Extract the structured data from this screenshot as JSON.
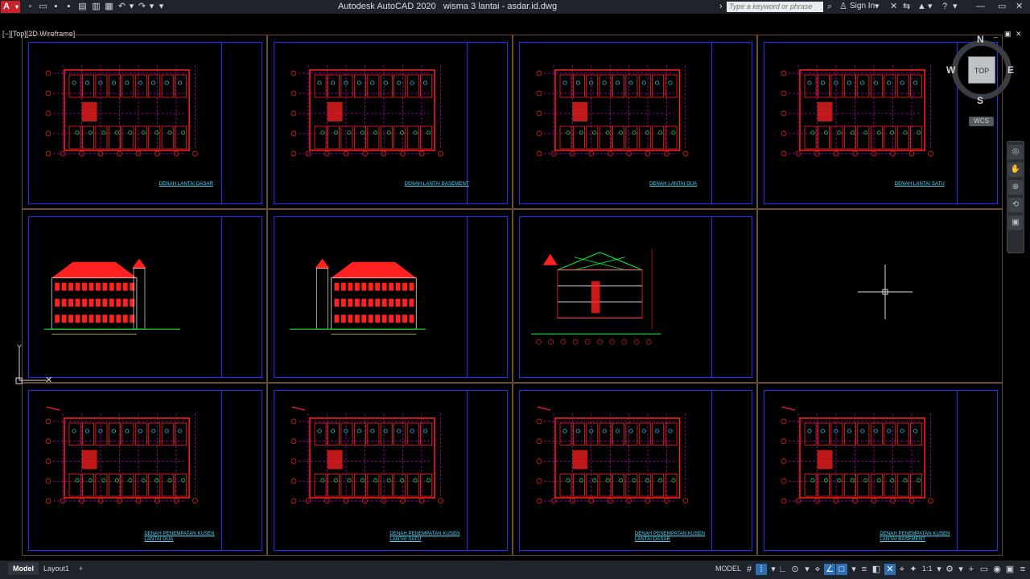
{
  "app": {
    "menu_logo": "A",
    "title": "Autodesk AutoCAD 2020   wisma 3 lantai - asdar.id.dwg"
  },
  "search": {
    "placeholder": "Type a keyword or phrase"
  },
  "account": {
    "sign_in": "Sign In"
  },
  "viewport": {
    "label": "[−][Top][2D Wireframe]",
    "controls": [
      "_",
      "▣",
      "✕"
    ]
  },
  "viewcube": {
    "top_face": "TOP",
    "north": "N",
    "south": "S",
    "west": "W",
    "east": "E",
    "wcs": "WCS"
  },
  "sheets": [
    {
      "title": "DENAH LANTAI DASAR",
      "type": "plan"
    },
    {
      "title": "DENAH LANTAI BASEMENT",
      "type": "plan"
    },
    {
      "title": "DENAH LANTAI DUA",
      "type": "plan"
    },
    {
      "title": "DENAH LANTAI SATU",
      "type": "plan"
    },
    {
      "title": "",
      "type": "elevation"
    },
    {
      "title": "",
      "type": "elevation"
    },
    {
      "title": "",
      "type": "section"
    },
    {
      "title": "",
      "type": "empty"
    },
    {
      "title": "DENAH PENEMPATAN KUSEN LANTAI DUA",
      "type": "kusen"
    },
    {
      "title": "DENAH PENEMPATAN KUSEN LANTAI SATU",
      "type": "kusen"
    },
    {
      "title": "DENAH PENEMPATAN KUSEN LANTAI DASAR",
      "type": "kusen"
    },
    {
      "title": "DENAH PENEMPATAN KUSEN LANTAI BASEMENT",
      "type": "kusen"
    }
  ],
  "tabs": {
    "model": "Model",
    "layout1": "Layout1",
    "add": "+"
  },
  "status": {
    "mode": "MODEL",
    "scale": "1:1"
  },
  "colors": {
    "accent": "#c8222a",
    "frame": "#2a2aff",
    "wall": "#ff2020",
    "grid": "#ff00ff",
    "door": "#3fe0ff",
    "green": "#00ff40"
  }
}
